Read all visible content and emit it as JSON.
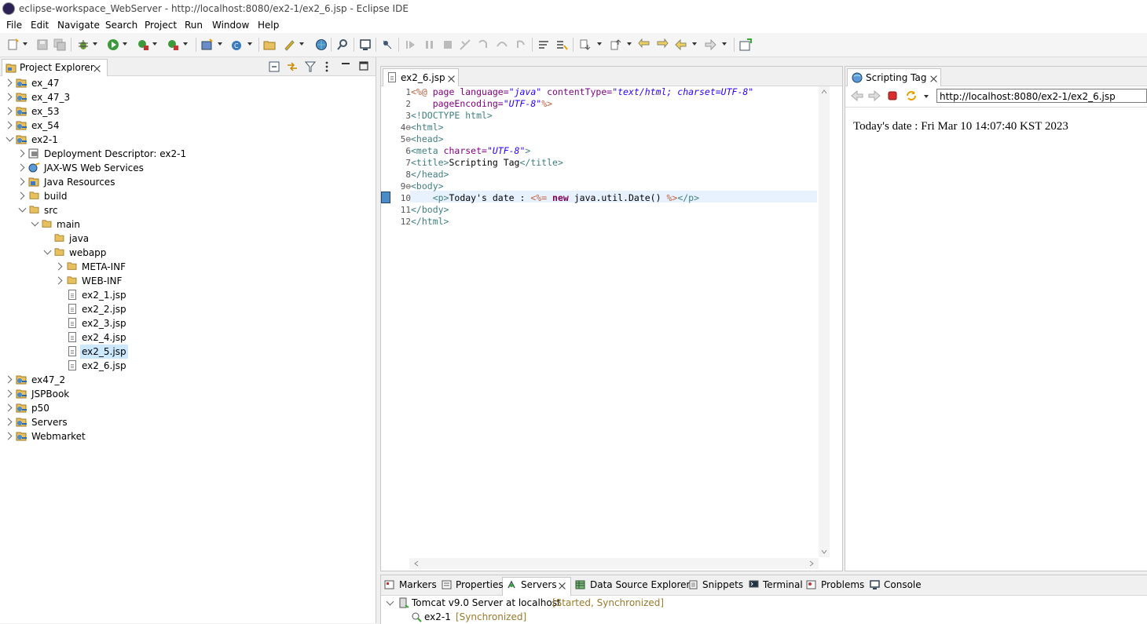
{
  "window": {
    "title": "eclipse-workspace_WebServer - http://localhost:8080/ex2-1/ex2_6.jsp - Eclipse IDE"
  },
  "menu": [
    "File",
    "Edit",
    "Navigate",
    "Search",
    "Project",
    "Run",
    "Window",
    "Help"
  ],
  "project_explorer": {
    "title": "Project Explorer",
    "items": [
      {
        "label": "ex_47",
        "type": "project",
        "level": 0,
        "state": "collapsed"
      },
      {
        "label": "ex_47_3",
        "type": "project",
        "level": 0,
        "state": "collapsed"
      },
      {
        "label": "ex_53",
        "type": "project",
        "level": 0,
        "state": "collapsed"
      },
      {
        "label": "ex_54",
        "type": "project",
        "level": 0,
        "state": "collapsed"
      },
      {
        "label": "ex2-1",
        "type": "project",
        "level": 0,
        "state": "expanded"
      },
      {
        "label": "Deployment Descriptor: ex2-1",
        "type": "descriptor",
        "level": 1,
        "state": "collapsed"
      },
      {
        "label": "JAX-WS Web Services",
        "type": "webservice",
        "level": 1,
        "state": "collapsed"
      },
      {
        "label": "Java Resources",
        "type": "resources",
        "level": 1,
        "state": "collapsed"
      },
      {
        "label": "build",
        "type": "folder",
        "level": 1,
        "state": "collapsed"
      },
      {
        "label": "src",
        "type": "folder",
        "level": 1,
        "state": "expanded"
      },
      {
        "label": "main",
        "type": "folder",
        "level": 2,
        "state": "expanded"
      },
      {
        "label": "java",
        "type": "folder",
        "level": 3,
        "state": "none"
      },
      {
        "label": "webapp",
        "type": "folder",
        "level": 3,
        "state": "expanded"
      },
      {
        "label": "META-INF",
        "type": "folder",
        "level": 4,
        "state": "collapsed"
      },
      {
        "label": "WEB-INF",
        "type": "folder",
        "level": 4,
        "state": "collapsed"
      },
      {
        "label": "ex2_1.jsp",
        "type": "file",
        "level": 4,
        "state": "none"
      },
      {
        "label": "ex2_2.jsp",
        "type": "file",
        "level": 4,
        "state": "none"
      },
      {
        "label": "ex2_3.jsp",
        "type": "file",
        "level": 4,
        "state": "none"
      },
      {
        "label": "ex2_4.jsp",
        "type": "file",
        "level": 4,
        "state": "none"
      },
      {
        "label": "ex2_5.jsp",
        "type": "file",
        "level": 4,
        "state": "none",
        "selected": true
      },
      {
        "label": "ex2_6.jsp",
        "type": "file",
        "level": 4,
        "state": "none"
      },
      {
        "label": "ex47_2",
        "type": "project",
        "level": 0,
        "state": "collapsed"
      },
      {
        "label": "JSPBook",
        "type": "project",
        "level": 0,
        "state": "collapsed"
      },
      {
        "label": "p50",
        "type": "project",
        "level": 0,
        "state": "collapsed"
      },
      {
        "label": "Servers",
        "type": "project",
        "level": 0,
        "state": "collapsed"
      },
      {
        "label": "Webmarket",
        "type": "project",
        "level": 0,
        "state": "collapsed"
      }
    ]
  },
  "editor": {
    "tab": "ex2_6.jsp",
    "line_numbers": [
      "1",
      "2",
      "3",
      "4⊖",
      "5⊖",
      "6",
      "7",
      "8",
      "9⊖",
      "10",
      "11",
      "12"
    ],
    "lines": [
      [
        [
          "j",
          "<%@ "
        ],
        [
          "k2",
          "page "
        ],
        [
          "a",
          "language="
        ],
        [
          "s",
          "\"java\" "
        ],
        [
          "a",
          "contentType="
        ],
        [
          "s",
          "\"text/html; charset=UTF-8\""
        ]
      ],
      [
        [
          "p",
          "    "
        ],
        [
          "a",
          "pageEncoding="
        ],
        [
          "s",
          "\"UTF-8\""
        ],
        [
          "j",
          "%>"
        ]
      ],
      [
        [
          "t",
          "<!DOCTYPE html>"
        ]
      ],
      [
        [
          "t",
          "<html>"
        ]
      ],
      [
        [
          "t",
          "<head>"
        ]
      ],
      [
        [
          "t",
          "<meta "
        ],
        [
          "a",
          "charset="
        ],
        [
          "s",
          "\"UTF-8\""
        ],
        [
          "t",
          ">"
        ]
      ],
      [
        [
          "t",
          "<title>"
        ],
        [
          "p",
          "Scripting Tag"
        ],
        [
          "t",
          "</title>"
        ]
      ],
      [
        [
          "t",
          "</head>"
        ]
      ],
      [
        [
          "t",
          "<body>"
        ]
      ],
      [
        [
          "p",
          "    "
        ],
        [
          "t",
          "<p>"
        ],
        [
          "p",
          "Today's date : "
        ],
        [
          "j",
          "<%= "
        ],
        [
          "k",
          "new "
        ],
        [
          "p",
          "java.util.Date() "
        ],
        [
          "j",
          "%>"
        ],
        [
          "t",
          "</p>"
        ]
      ],
      [
        [
          "t",
          "</body>"
        ]
      ],
      [
        [
          "t",
          "</html>"
        ]
      ]
    ]
  },
  "browser": {
    "tab": "Scripting Tag",
    "url": "http://localhost:8080/ex2-1/ex2_6.jsp",
    "content": "Today's date : Fri Mar 10 14:07:40 KST 2023"
  },
  "bottom": {
    "tabs": [
      "Markers",
      "Properties",
      "Servers",
      "Data Source Explorer",
      "Snippets",
      "Terminal",
      "Problems",
      "Console"
    ],
    "active_tab": "Servers",
    "servers": [
      {
        "name": "Tomcat v9.0 Server at localhost",
        "status": "[Started, Synchronized]"
      },
      {
        "name": "ex2-1",
        "status": "[Synchronized]"
      }
    ]
  },
  "colors": {
    "tag": "#3f7f7f",
    "attr": "#7f007f",
    "string": "#2a00ff",
    "jsp": "#bf5f3f",
    "keyword": "#7f0055",
    "selection": "#cce8ff"
  }
}
